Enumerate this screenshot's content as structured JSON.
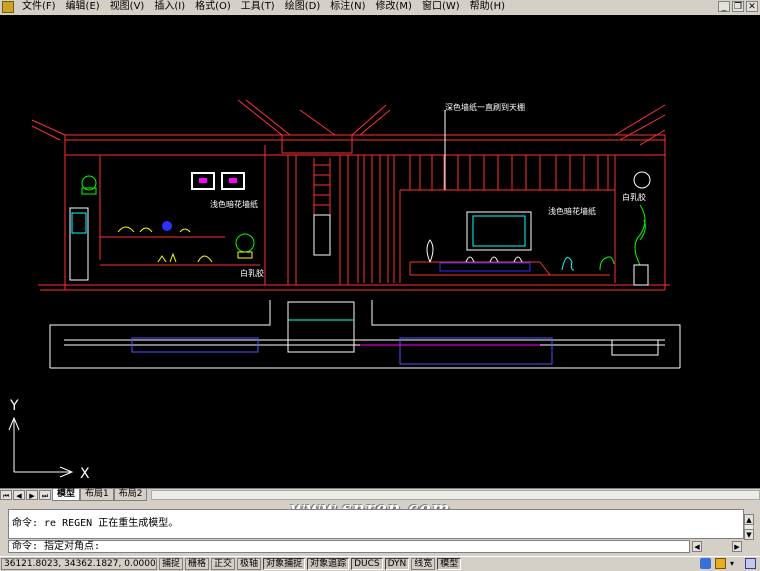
{
  "menubar": {
    "items": [
      "文件(F)",
      "编辑(E)",
      "视图(V)",
      "插入(I)",
      "格式(O)",
      "工具(T)",
      "绘图(D)",
      "标注(N)",
      "修改(M)",
      "窗口(W)",
      "帮助(H)"
    ]
  },
  "drawing": {
    "label_top": "深色墙纸一直刷到天棚",
    "label_left_wall": "浅色暗花墙纸",
    "label_right_wall": "浅色暗花墙纸",
    "label_cabinet_left": "白乳胶",
    "label_cabinet_right": "白乳胶"
  },
  "ucs": {
    "x_label": "X",
    "y_label": "Y"
  },
  "layout_tabs": [
    "模型",
    "布局1",
    "布局2"
  ],
  "command": {
    "history_line": "命令: re REGEN 正在重生成模型。",
    "prompt_line": "命令: 指定对角点:"
  },
  "watermark": "www.snren.com",
  "status": {
    "coords": "36121.8023, 34362.1827, 0.0000",
    "toggles": [
      "捕捉",
      "栅格",
      "正交",
      "极轴",
      "对象捕捉",
      "对象追踪",
      "DUCS",
      "DYN",
      "线宽",
      "模型"
    ],
    "toggles_on": [
      "对象捕捉",
      "对象追踪",
      "DUCS",
      "DYN",
      "模型"
    ]
  },
  "colors": {
    "red": "#ff3030",
    "white": "#ffffff",
    "yellow": "#ffff00",
    "green": "#00ff00",
    "cyan": "#00ffff",
    "magenta": "#ff00ff",
    "blue": "#5050ff"
  }
}
